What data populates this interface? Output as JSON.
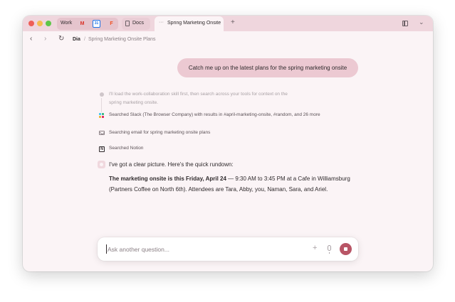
{
  "tabbar": {
    "group_label": "Work",
    "favicons": {
      "gmail": "M",
      "calendar": "31",
      "figma": "F"
    },
    "docs_tab_label": "Docs",
    "active_tab_label": "Spring Marketing Onsite",
    "active_tab_dots": "···",
    "new_tab": "+",
    "tabs_chevron": "⌄"
  },
  "addressbar": {
    "back": "‹",
    "forward": "›",
    "reload": "↻",
    "root": "Dia",
    "separator": "/",
    "page": "Spring Marketing Onsite Plans"
  },
  "chat": {
    "user_message": "Catch me up on the latest plans for the spring marketing onsite",
    "steps": {
      "thought": "I'll load the work-collaboration skill first, then search across your tools for context on the spring marketing onsite.",
      "slack": "Searched Slack (The Browser Company) with results in #april-marketing-onsite, #random, and 26 more",
      "email": "Searching email for spring marketing onsite plans",
      "notion": "Searched Notion",
      "notion_glyph": "N"
    },
    "answer_intro": "I've got a clear picture. Here's the quick rundown:",
    "answer_bold": "The marketing onsite is this Friday, April 24",
    "answer_rest": " — 9:30 AM to 3:45 PM at a Cafe in Williamsburg (Partners Coffee on North 6th). Attendees are Tara, Abby, you, Naman, Sara, and Ariel."
  },
  "composer": {
    "placeholder": "Ask another question...",
    "plus": "+"
  },
  "colors": {
    "tabbar_bg": "#efd6dd",
    "window_bg": "#fbf4f6",
    "user_bubble": "#ecc9d2",
    "stop_button": "#b85566"
  },
  "icons": {
    "slack": "slack-icon",
    "email": "mail-icon",
    "notion": "notion-icon",
    "assistant": "assistant-icon",
    "mic": "mic-icon",
    "stop": "stop-icon"
  }
}
